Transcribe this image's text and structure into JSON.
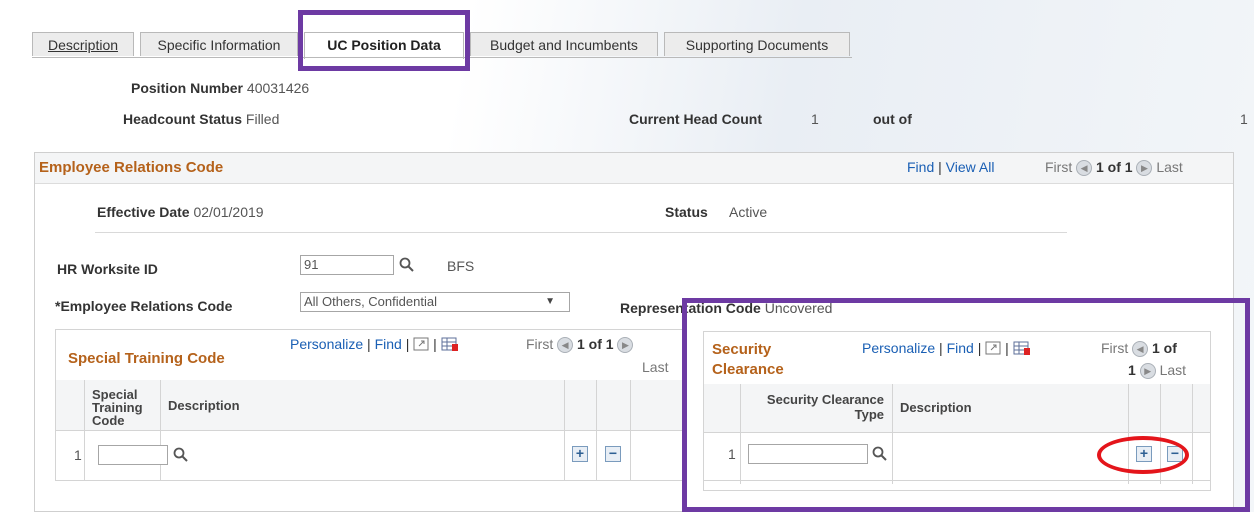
{
  "tabs": [
    {
      "label": "Description"
    },
    {
      "label": "Specific Information"
    },
    {
      "label": "UC Position Data"
    },
    {
      "label": "Budget and Incumbents"
    },
    {
      "label": "Supporting Documents"
    }
  ],
  "position": {
    "number_label": "Position Number",
    "number_value": "40031426",
    "headcount_status_label": "Headcount Status",
    "headcount_status_value": "Filled",
    "current_head_count_label": "Current Head Count",
    "current_head_count_value": "1",
    "out_of_label": "out of",
    "out_of_value": "1"
  },
  "erc_panel": {
    "title": "Employee Relations Code",
    "find": "Find",
    "view_all": "View All",
    "sep": "|",
    "first": "First",
    "count": "1 of 1",
    "last": "Last",
    "effective_date_label": "Effective Date",
    "effective_date_value": "02/01/2019",
    "status_label": "Status",
    "status_value": "Active",
    "hr_worksite_label": "HR Worksite ID",
    "hr_worksite_value": "91",
    "hr_worksite_desc": "BFS",
    "erc_label": "*Employee Relations Code",
    "erc_value": "All Others, Confidential",
    "representation_label": "Representation Code",
    "representation_value": "Uncovered"
  },
  "special_training": {
    "title": "Special Training Code",
    "personalize": "Personalize",
    "find": "Find",
    "sep": "|",
    "first": "First",
    "count": "1 of 1",
    "last": "Last",
    "col_code": "Special Training Code",
    "col_desc": "Description",
    "row_num": "1",
    "row_value": ""
  },
  "security_clearance": {
    "title": "Security Clearance",
    "personalize": "Personalize",
    "find": "Find",
    "sep": "|",
    "first": "First",
    "count_a": "1 of",
    "count_b": "1",
    "last": "Last",
    "col_type": "Security Clearance Type",
    "col_desc": "Description",
    "row_num": "1",
    "row_value": ""
  },
  "icons": {
    "add": "+",
    "remove": "−",
    "dropdown": "▼",
    "prev": "◀",
    "next": "▶"
  },
  "colors": {
    "highlight": "#6d3aa3",
    "annotation": "#e4151b",
    "section_title": "#b5621b",
    "link": "#1a5fb4"
  }
}
